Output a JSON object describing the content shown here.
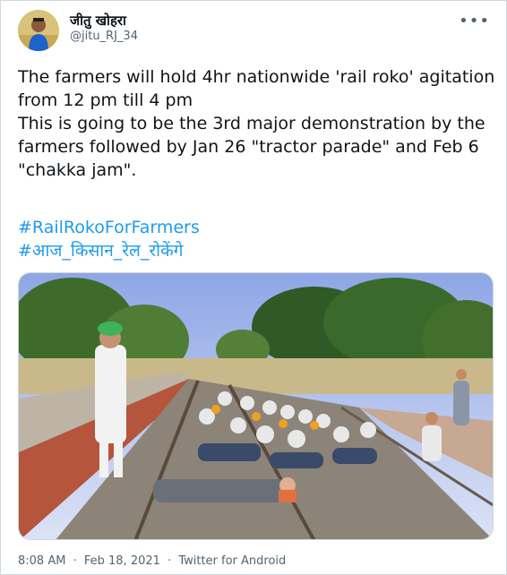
{
  "user": {
    "display_name": "जीतु खोहरा",
    "handle": "@jitu_RJ_34"
  },
  "more_icon": "more-horizontal-icon",
  "tweet": {
    "paragraphs": [
      "The farmers will hold 4hr nationwide 'rail roko' agitation\nfrom 12 pm till 4 pm",
      "This is going to be the 3rd major demonstration by the\nfarmers followed by Jan 26 \"tractor parade\" and Feb 6\n\"chakka jam\"."
    ],
    "hashtags": [
      "#RailRokoForFarmers",
      "#आज_किसान_रेल_रोकेंगे"
    ]
  },
  "meta": {
    "time": "8:08 AM",
    "separator": "·",
    "date": "Feb 18, 2021",
    "source": "Twitter for Android"
  },
  "colors": {
    "link": "#1d9bf0",
    "text": "#0f1419",
    "secondary": "#536471",
    "border": "#cfd9de"
  }
}
